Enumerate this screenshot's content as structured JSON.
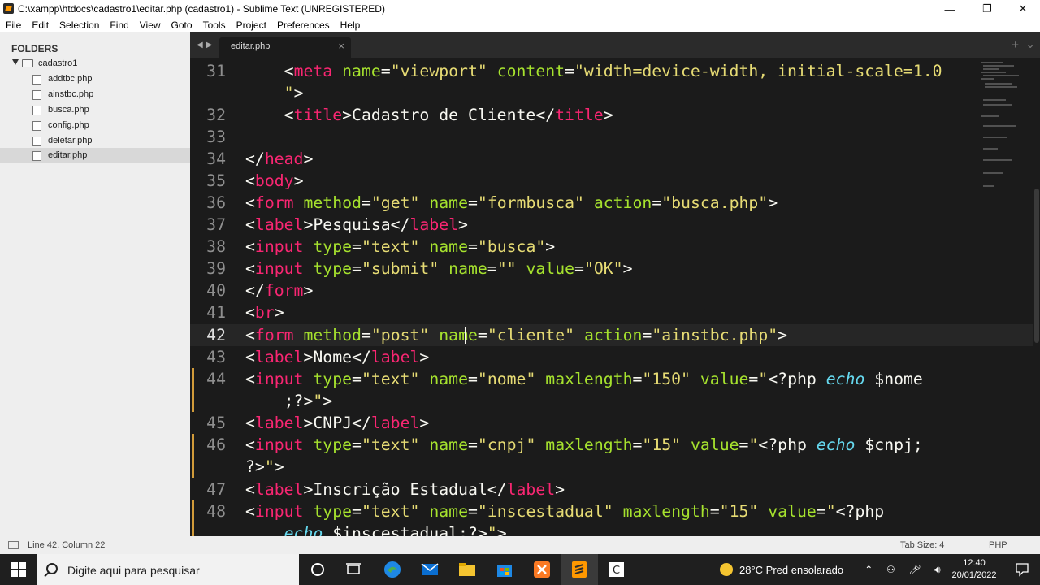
{
  "window": {
    "title": "C:\\xampp\\htdocs\\cadastro1\\editar.php (cadastro1) - Sublime Text (UNREGISTERED)"
  },
  "menu": [
    "File",
    "Edit",
    "Selection",
    "Find",
    "View",
    "Goto",
    "Tools",
    "Project",
    "Preferences",
    "Help"
  ],
  "sidebar": {
    "heading": "FOLDERS",
    "folder": "cadastro1",
    "files": [
      "addtbc.php",
      "ainstbc.php",
      "busca.php",
      "config.php",
      "deletar.php",
      "editar.php"
    ],
    "selected_file": "editar.php"
  },
  "tabs": [
    {
      "label": "editar.php",
      "active": true
    }
  ],
  "editor": {
    "current_line": "42",
    "line_numbers": [
      "31",
      "",
      "32",
      "33",
      "34",
      "35",
      "36",
      "37",
      "38",
      "39",
      "40",
      "41",
      "42",
      "43",
      "44",
      "",
      "45",
      "46",
      "",
      "47",
      "48",
      ""
    ]
  },
  "status": {
    "position": "Line 42, Column 22",
    "tab_size": "Tab Size: 4",
    "syntax": "PHP"
  },
  "taskbar": {
    "search_placeholder": "Digite aqui para pesquisar",
    "weather": "28°C  Pred ensolarado",
    "time": "12:40",
    "date": "20/01/2022"
  },
  "colors": {
    "tag": "#f92672",
    "attribute": "#a6e22e",
    "string": "#e6db74",
    "keyword": "#66d9ef",
    "modified_marker": "#d19b3a"
  }
}
